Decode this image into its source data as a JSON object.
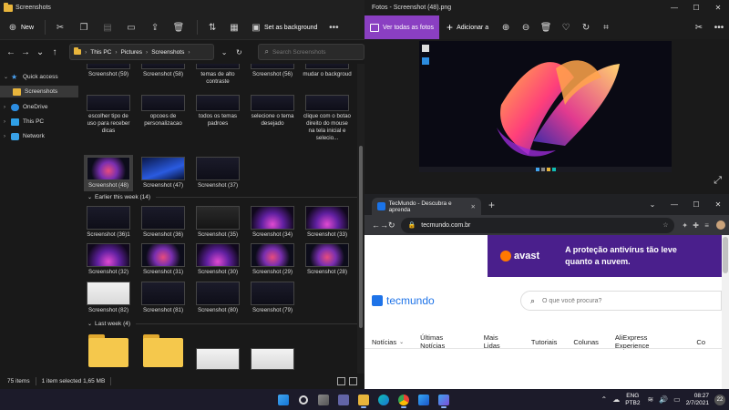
{
  "explorer": {
    "title": "Screenshots",
    "toolbar": {
      "new_label": "New",
      "set_bg_label": "Set as background"
    },
    "address": [
      "This PC",
      "Pictures",
      "Screenshots"
    ],
    "search_placeholder": "Search Screenshots",
    "nav": [
      {
        "label": "Quick access"
      },
      {
        "label": "Screenshots"
      },
      {
        "label": "OneDrive"
      },
      {
        "label": "This PC"
      },
      {
        "label": "Network"
      }
    ],
    "row_top": [
      "Screenshot (59)",
      "Screenshot (58)",
      "temas de alto contraste",
      "Screenshot (56)",
      "mudar o backgroud"
    ],
    "row_2": [
      "escolher tipo de uso para receber dicas",
      "opcoes de personalizacao",
      "todos os temas padroes",
      "selecione o tema desejado",
      "clique com o botao direito do mouse na tela inicial e selecio..."
    ],
    "row_3": [
      "Screenshot (48)",
      "Screenshot (47)",
      "Screenshot (37)"
    ],
    "group_week": "Earlier this week (14)",
    "row_4": [
      "Screenshot (36)1",
      "Screenshot (36)",
      "Screenshot (35)",
      "Screenshot (34)",
      "Screenshot (33)"
    ],
    "row_5": [
      "Screenshot (32)",
      "Screenshot (31)",
      "Screenshot (30)",
      "Screenshot (29)",
      "Screenshot (28)"
    ],
    "row_6": [
      "Screenshot (82)",
      "Screenshot (81)",
      "Screenshot (80)",
      "Screenshot (79)"
    ],
    "group_last": "Last week (4)",
    "status": {
      "items": "75 items",
      "selected": "1 item selected  1,65 MB"
    }
  },
  "photos": {
    "title": "Fotos - Screenshot (48).png",
    "view_all": "Ver todas as fotos",
    "add": "Adicionar a"
  },
  "chrome": {
    "tab_title": "TecMundo - Descubra e aprenda",
    "url": "tecmundo.com.br",
    "ad_brand": "avast",
    "ad_slogan_1": "A proteção antivírus tão leve",
    "ad_slogan_2": "quanto a nuvem.",
    "logo": "tecmundo",
    "search_placeholder": "O que você procura?",
    "menu": [
      "Notícias",
      "Últimas Notícias",
      "Mais Lidas",
      "Tutoriais",
      "Colunas",
      "AliExpress Experience",
      "Co"
    ]
  },
  "taskbar": {
    "lang_1": "ENG",
    "lang_2": "PTB2",
    "time": "08:27",
    "date": "2/7/2021",
    "notif_count": "22"
  },
  "colors": {
    "photos_accent": "#8a3fc2",
    "ad_bg": "#4a1f8c",
    "tecmundo_blue": "#1e73e8"
  }
}
